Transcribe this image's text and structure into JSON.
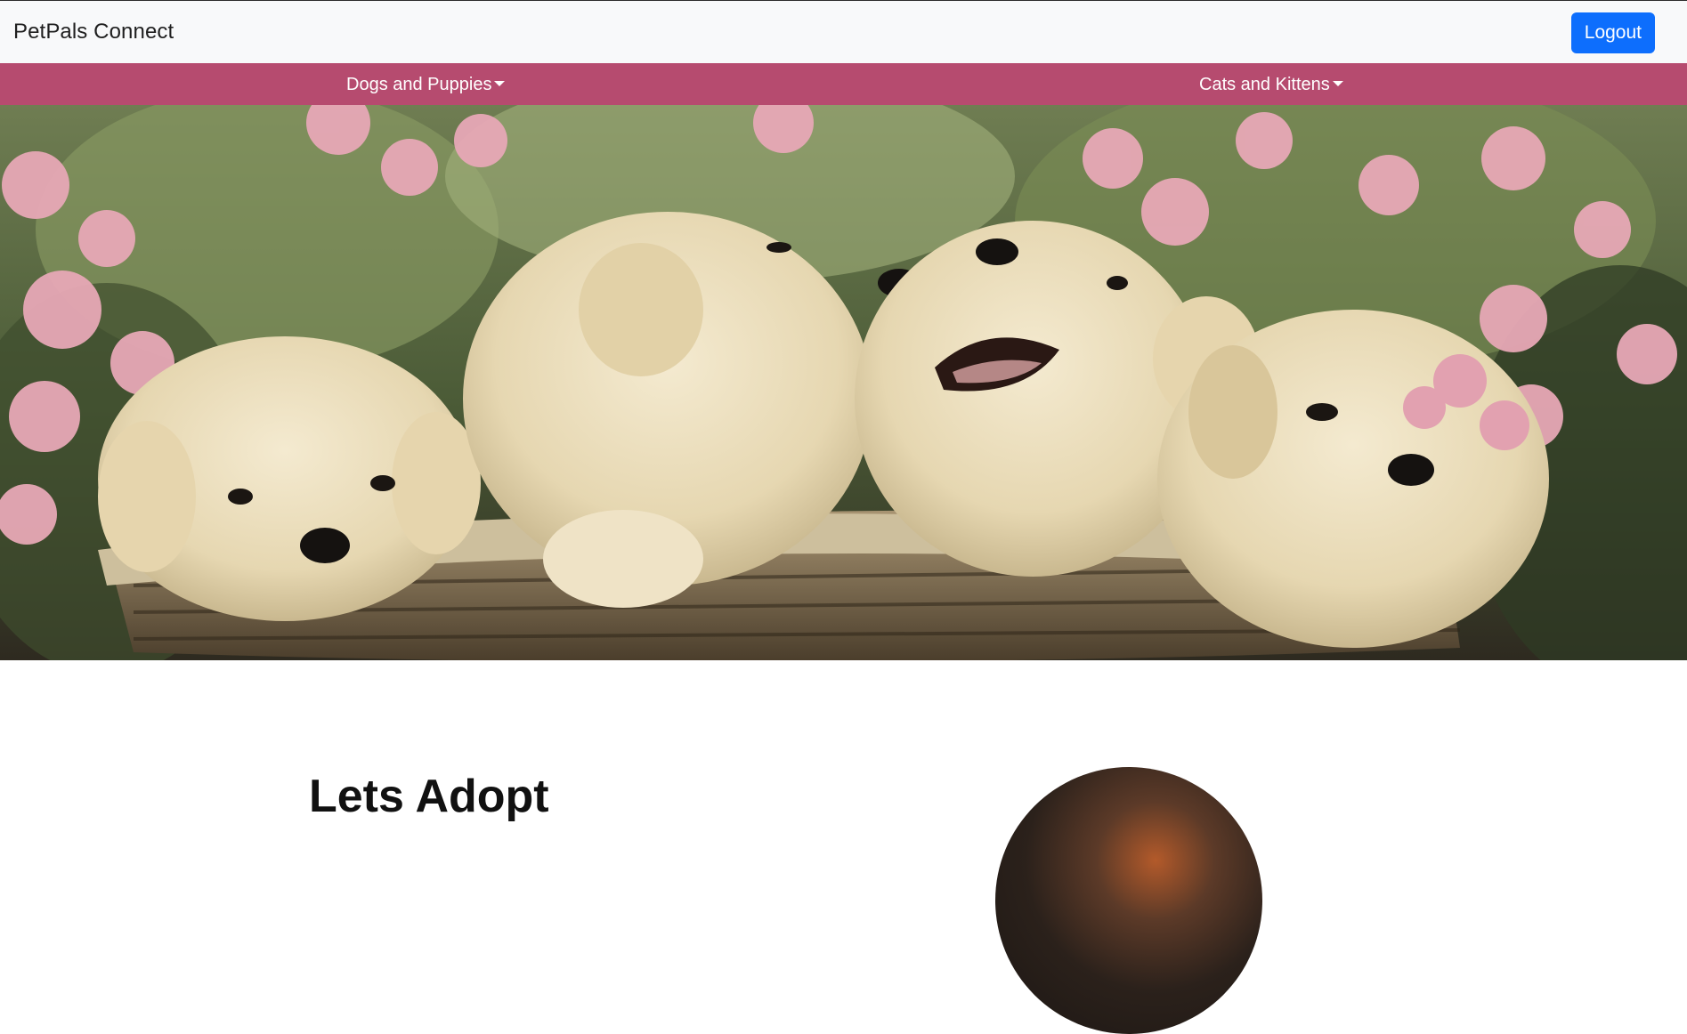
{
  "header": {
    "brand": "PetPals Connect",
    "logout_label": "Logout"
  },
  "categories": [
    {
      "label": "Dogs and Puppies"
    },
    {
      "label": "Cats and Kittens"
    }
  ],
  "section": {
    "title": "Lets Adopt"
  },
  "colors": {
    "topbar_bg": "#f8f9fa",
    "catbar_bg": "#b64b6f",
    "logout_bg": "#0d6efd"
  },
  "icons": {
    "dropdown": "caret-down-icon"
  }
}
